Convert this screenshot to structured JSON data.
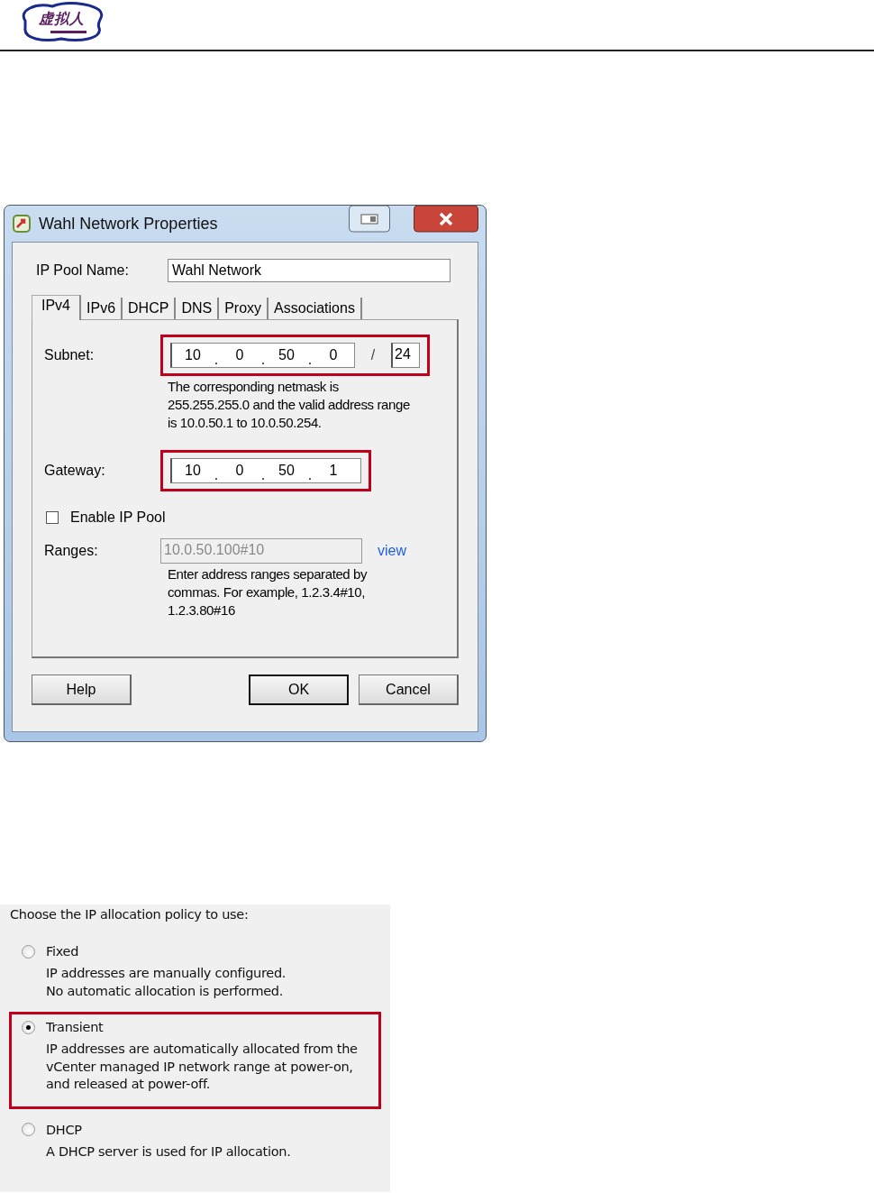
{
  "header": {
    "logo_text": "虚拟人"
  },
  "dialog": {
    "title": "Wahl Network Properties",
    "pool_name_label": "IP Pool Name:",
    "pool_name": "Wahl Network",
    "tabs": [
      {
        "label": "IPv4",
        "selected": true
      },
      {
        "label": "IPv6",
        "selected": false
      },
      {
        "label": "DHCP",
        "selected": false
      },
      {
        "label": "DNS",
        "selected": false
      },
      {
        "label": "Proxy",
        "selected": false
      },
      {
        "label": "Associations",
        "selected": false
      }
    ],
    "subnet": {
      "label": "Subnet:",
      "octets": [
        "10",
        "0",
        "50",
        "0"
      ],
      "octet_separator": ".",
      "prefix_separator": "/",
      "prefix": "24",
      "highlighted": true
    },
    "subnet_note": "The corresponding netmask is\n255.255.255.0 and the valid address range\nis 10.0.50.1 to 10.0.50.254.",
    "gateway": {
      "label": "Gateway:",
      "octets": [
        "10",
        "0",
        "50",
        "1"
      ],
      "octet_separator": ".",
      "highlighted": true
    },
    "enable_pool": {
      "label": "Enable IP Pool",
      "checked": false
    },
    "ranges": {
      "label": "Ranges:",
      "value": "10.0.50.100#10",
      "disabled": true,
      "link": "view"
    },
    "ranges_note": "Enter address ranges separated by\ncommas. For example, 1.2.3.4#10,\n1.2.3.80#16",
    "buttons": [
      {
        "label": "Help",
        "default": false
      },
      {
        "label": "OK",
        "default": true
      },
      {
        "label": "Cancel",
        "default": false
      }
    ]
  },
  "policy": {
    "prompt": "Choose the IP allocation policy to use:",
    "options": [
      {
        "label": "Fixed",
        "description": "IP addresses are manually configured.\nNo automatic allocation is performed.",
        "selected": false,
        "highlighted": false
      },
      {
        "label": "Transient",
        "description": "IP addresses are automatically allocated from the\nvCenter managed IP network range at power-on,\nand released at power-off.",
        "selected": true,
        "highlighted": true
      },
      {
        "label": "DHCP",
        "description": "A DHCP server is used for IP allocation.",
        "selected": false,
        "highlighted": false
      }
    ]
  }
}
